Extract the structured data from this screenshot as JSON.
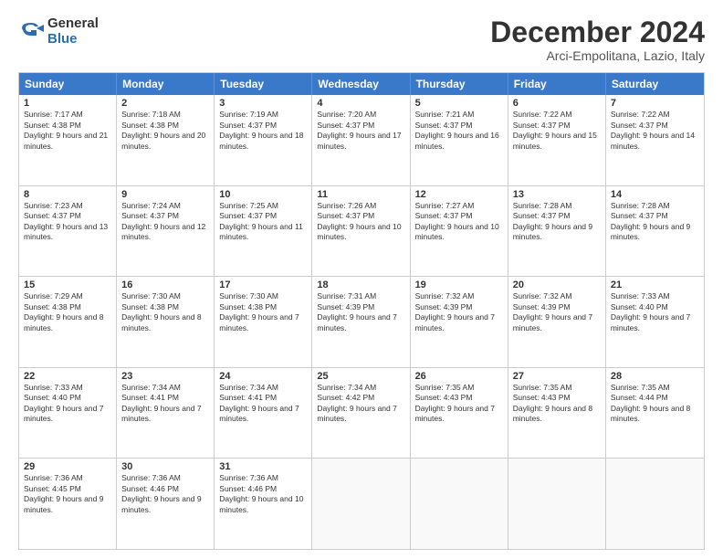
{
  "logo": {
    "general": "General",
    "blue": "Blue"
  },
  "title": "December 2024",
  "location": "Arci-Empolitana, Lazio, Italy",
  "days": [
    "Sunday",
    "Monday",
    "Tuesday",
    "Wednesday",
    "Thursday",
    "Friday",
    "Saturday"
  ],
  "weeks": [
    [
      {
        "day": "1",
        "sunrise": "7:17 AM",
        "sunset": "4:38 PM",
        "daylight": "9 hours and 21 minutes"
      },
      {
        "day": "2",
        "sunrise": "7:18 AM",
        "sunset": "4:38 PM",
        "daylight": "9 hours and 20 minutes"
      },
      {
        "day": "3",
        "sunrise": "7:19 AM",
        "sunset": "4:37 PM",
        "daylight": "9 hours and 18 minutes"
      },
      {
        "day": "4",
        "sunrise": "7:20 AM",
        "sunset": "4:37 PM",
        "daylight": "9 hours and 17 minutes"
      },
      {
        "day": "5",
        "sunrise": "7:21 AM",
        "sunset": "4:37 PM",
        "daylight": "9 hours and 16 minutes"
      },
      {
        "day": "6",
        "sunrise": "7:22 AM",
        "sunset": "4:37 PM",
        "daylight": "9 hours and 15 minutes"
      },
      {
        "day": "7",
        "sunrise": "7:22 AM",
        "sunset": "4:37 PM",
        "daylight": "9 hours and 14 minutes"
      }
    ],
    [
      {
        "day": "8",
        "sunrise": "7:23 AM",
        "sunset": "4:37 PM",
        "daylight": "9 hours and 13 minutes"
      },
      {
        "day": "9",
        "sunrise": "7:24 AM",
        "sunset": "4:37 PM",
        "daylight": "9 hours and 12 minutes"
      },
      {
        "day": "10",
        "sunrise": "7:25 AM",
        "sunset": "4:37 PM",
        "daylight": "9 hours and 11 minutes"
      },
      {
        "day": "11",
        "sunrise": "7:26 AM",
        "sunset": "4:37 PM",
        "daylight": "9 hours and 10 minutes"
      },
      {
        "day": "12",
        "sunrise": "7:27 AM",
        "sunset": "4:37 PM",
        "daylight": "9 hours and 10 minutes"
      },
      {
        "day": "13",
        "sunrise": "7:28 AM",
        "sunset": "4:37 PM",
        "daylight": "9 hours and 9 minutes"
      },
      {
        "day": "14",
        "sunrise": "7:28 AM",
        "sunset": "4:37 PM",
        "daylight": "9 hours and 9 minutes"
      }
    ],
    [
      {
        "day": "15",
        "sunrise": "7:29 AM",
        "sunset": "4:38 PM",
        "daylight": "9 hours and 8 minutes"
      },
      {
        "day": "16",
        "sunrise": "7:30 AM",
        "sunset": "4:38 PM",
        "daylight": "9 hours and 8 minutes"
      },
      {
        "day": "17",
        "sunrise": "7:30 AM",
        "sunset": "4:38 PM",
        "daylight": "9 hours and 7 minutes"
      },
      {
        "day": "18",
        "sunrise": "7:31 AM",
        "sunset": "4:39 PM",
        "daylight": "9 hours and 7 minutes"
      },
      {
        "day": "19",
        "sunrise": "7:32 AM",
        "sunset": "4:39 PM",
        "daylight": "9 hours and 7 minutes"
      },
      {
        "day": "20",
        "sunrise": "7:32 AM",
        "sunset": "4:39 PM",
        "daylight": "9 hours and 7 minutes"
      },
      {
        "day": "21",
        "sunrise": "7:33 AM",
        "sunset": "4:40 PM",
        "daylight": "9 hours and 7 minutes"
      }
    ],
    [
      {
        "day": "22",
        "sunrise": "7:33 AM",
        "sunset": "4:40 PM",
        "daylight": "9 hours and 7 minutes"
      },
      {
        "day": "23",
        "sunrise": "7:34 AM",
        "sunset": "4:41 PM",
        "daylight": "9 hours and 7 minutes"
      },
      {
        "day": "24",
        "sunrise": "7:34 AM",
        "sunset": "4:41 PM",
        "daylight": "9 hours and 7 minutes"
      },
      {
        "day": "25",
        "sunrise": "7:34 AM",
        "sunset": "4:42 PM",
        "daylight": "9 hours and 7 minutes"
      },
      {
        "day": "26",
        "sunrise": "7:35 AM",
        "sunset": "4:43 PM",
        "daylight": "9 hours and 7 minutes"
      },
      {
        "day": "27",
        "sunrise": "7:35 AM",
        "sunset": "4:43 PM",
        "daylight": "9 hours and 8 minutes"
      },
      {
        "day": "28",
        "sunrise": "7:35 AM",
        "sunset": "4:44 PM",
        "daylight": "9 hours and 8 minutes"
      }
    ],
    [
      {
        "day": "29",
        "sunrise": "7:36 AM",
        "sunset": "4:45 PM",
        "daylight": "9 hours and 9 minutes"
      },
      {
        "day": "30",
        "sunrise": "7:36 AM",
        "sunset": "4:46 PM",
        "daylight": "9 hours and 9 minutes"
      },
      {
        "day": "31",
        "sunrise": "7:36 AM",
        "sunset": "4:46 PM",
        "daylight": "9 hours and 10 minutes"
      },
      null,
      null,
      null,
      null
    ]
  ]
}
